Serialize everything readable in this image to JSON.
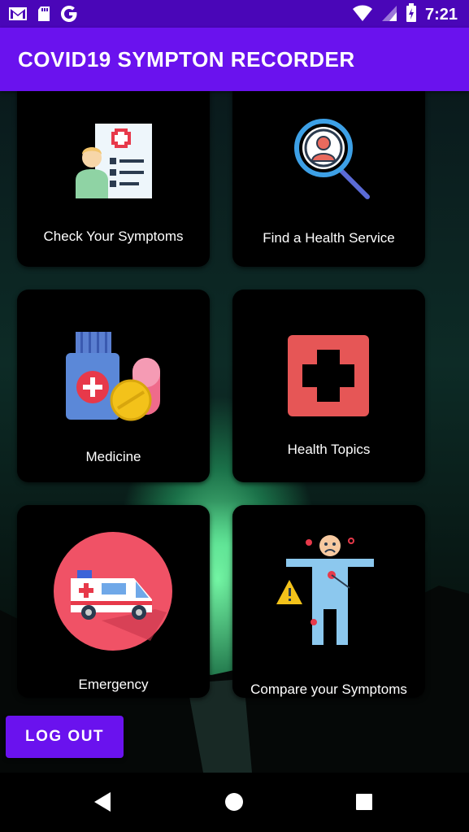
{
  "status_bar": {
    "time": "7:21",
    "icons": [
      "gmail-icon",
      "sd-card-icon",
      "google-icon",
      "wifi-icon",
      "signal-icon",
      "battery-charging-icon"
    ]
  },
  "app_bar": {
    "title": "COVID19 SYMPTON RECORDER"
  },
  "tiles": [
    {
      "label": "Check Your Symptoms",
      "icon": "doctor-checklist-icon"
    },
    {
      "label": "Find a Health Service",
      "icon": "search-person-icon"
    },
    {
      "label": "Medicine",
      "icon": "medicine-bottle-icon"
    },
    {
      "label": "Health Topics",
      "icon": "red-cross-icon"
    },
    {
      "label": "Emergency",
      "icon": "ambulance-icon"
    },
    {
      "label": "Compare your  Symptoms",
      "icon": "sick-person-icon"
    }
  ],
  "logout_label": "LOG OUT",
  "nav": [
    "back-icon",
    "home-icon",
    "recents-icon"
  ],
  "colors": {
    "status_bar": "#4a06b8",
    "app_bar": "#6a12ee",
    "button": "#6a12ee",
    "tile": "#000000"
  }
}
